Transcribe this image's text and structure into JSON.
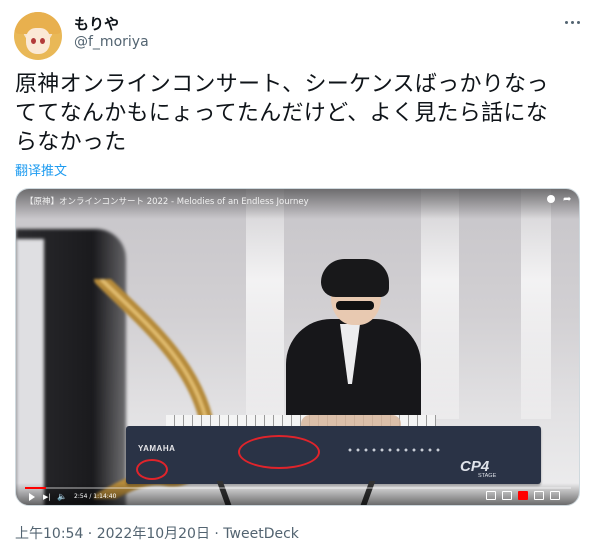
{
  "author": {
    "display_name": "もりや",
    "handle": "@f_moriya"
  },
  "tweet": {
    "text": "原神オンラインコンサート、シーケンスばっかりなっ\nててなんかもにょってたんだけど、よく見たら話にな\nらなかった",
    "translate_label": "翻译推文",
    "meta": "上午10:54 · 2022年10月20日 · TweetDeck"
  },
  "video": {
    "title": "【原神】オンラインコンサート 2022 - Melodies of an Endless Journey",
    "time": "2:54 / 1:14:40",
    "progress": 0.039,
    "keyboard_brand": "YAMAHA",
    "keyboard_model": "CP4",
    "keyboard_model_sub": "STAGE"
  },
  "colors": {
    "link": "#1d9bf0",
    "muted": "#536471",
    "annotation": "#e0242b",
    "progress": "#ff0000"
  }
}
